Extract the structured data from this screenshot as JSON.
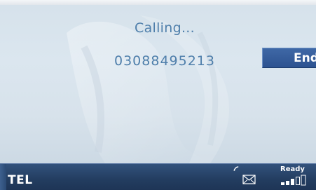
{
  "call": {
    "status": "Calling...",
    "number": "03088495213"
  },
  "actions": {
    "end_label": "End"
  },
  "status_bar": {
    "mode_label": "TEL",
    "network_status": "Ready",
    "signal_bars_lit": 3,
    "signal_bars_total": 5
  },
  "icons": {
    "handset": "phone-handset-icon",
    "message": "envelope-icon",
    "signal": "signal-strength-icon"
  },
  "colors": {
    "accent_text": "#4f7fab",
    "button": "#2f5693",
    "status_bar": "#233d60"
  }
}
